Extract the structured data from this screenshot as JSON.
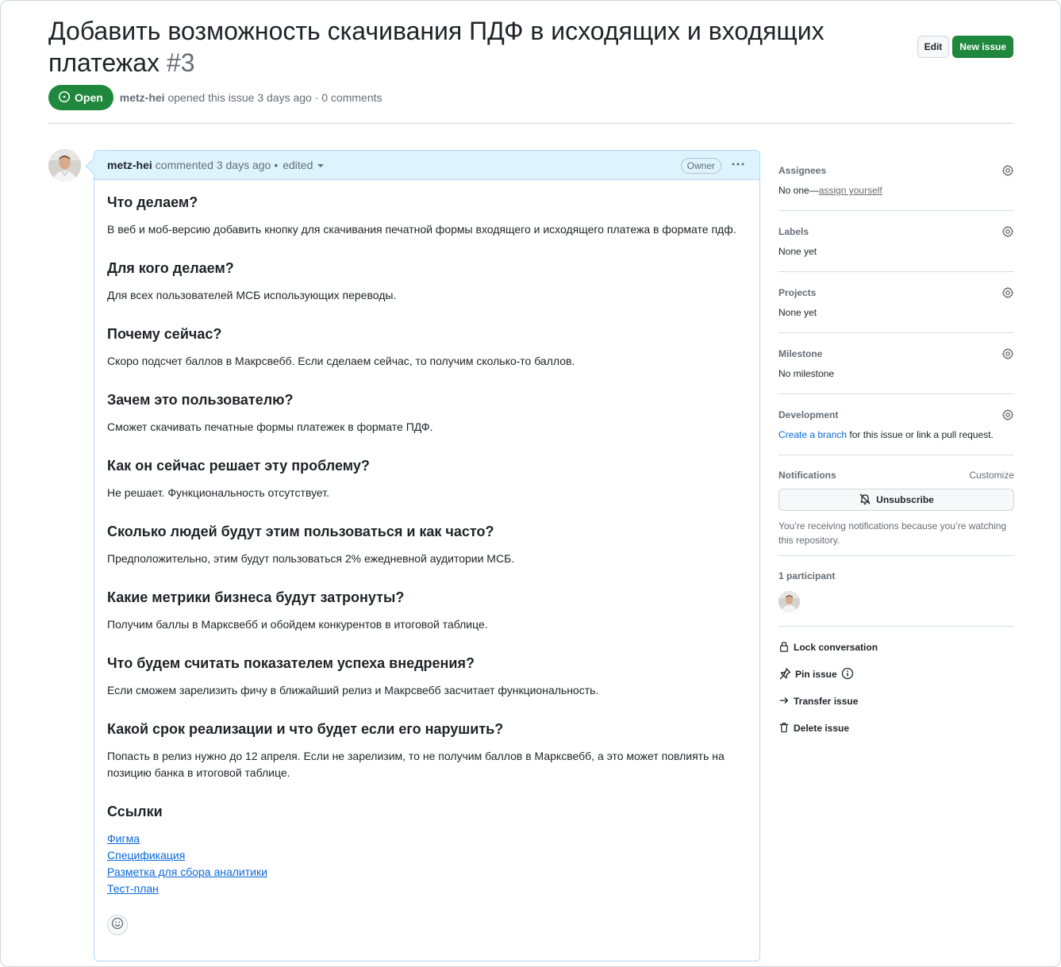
{
  "issue": {
    "title": "Добавить возможность скачивания ПДФ в исходящих и входящих платежах",
    "number": "#3",
    "state": "Open",
    "author": "metz-hei",
    "meta_rest": "opened this issue 3 days ago · 0 comments"
  },
  "actions": {
    "edit": "Edit",
    "new_issue": "New issue"
  },
  "comment": {
    "author": "metz-hei",
    "commented": "commented 3 days ago",
    "separator": "•",
    "edited": "edited",
    "owner_badge": "Owner",
    "sections": [
      {
        "heading": "Что делаем?",
        "text": "В веб и моб-версию добавить кнопку для скачивания печатной формы входящего и исходящего платежа в формате пдф."
      },
      {
        "heading": "Для кого делаем?",
        "text": "Для всех пользователей МСБ использующих переводы."
      },
      {
        "heading": "Почему сейчас?",
        "text": "Скоро подсчет баллов в Макрсвебб. Если сделаем сейчас, то получим сколько-то баллов."
      },
      {
        "heading": "Зачем это пользователю?",
        "text": "Сможет скачивать печатные формы платежек в формате ПДФ."
      },
      {
        "heading": "Как он сейчас решает эту проблему?",
        "text": "Не решает. Функциональность отсутствует."
      },
      {
        "heading": "Сколько людей будут этим пользоваться и как часто?",
        "text": "Предположительно, этим будут пользоваться 2% ежедневной аудитории МСБ."
      },
      {
        "heading": "Какие метрики бизнеса будут затронуты?",
        "text": "Получим баллы в Марксвебб и обойдем конкурентов в итоговой таблице."
      },
      {
        "heading": "Что будем считать показателем успеха внедрения?",
        "text": "Если сможем зарелизить фичу в ближайший релиз и Макрсвебб засчитает функциональность."
      },
      {
        "heading": "Какой срок реализации и что будет если его нарушить?",
        "text": "Попасть в релиз нужно до 12 апреля. Если не зарелизим, то не получим баллов в Марксвебб, а это может повлиять на позицию банка в итоговой таблице."
      }
    ],
    "links_heading": "Ссылки",
    "links": [
      "Фигма",
      "Спецификация",
      "Разметка для сбора аналитики",
      "Тест-план"
    ]
  },
  "sidebar": {
    "assignees": {
      "title": "Assignees",
      "value_prefix": "No one—",
      "value_link": "assign yourself"
    },
    "labels": {
      "title": "Labels",
      "value": "None yet"
    },
    "projects": {
      "title": "Projects",
      "value": "None yet"
    },
    "milestone": {
      "title": "Milestone",
      "value": "No milestone"
    },
    "development": {
      "title": "Development",
      "link": "Create a branch",
      "rest": " for this issue or link a pull request."
    },
    "notifications": {
      "title": "Notifications",
      "customize": "Customize",
      "button": "Unsubscribe",
      "note": "You’re receiving notifications because you’re watching this repository."
    },
    "participants": {
      "title": "1 participant"
    },
    "actions": {
      "lock": "Lock conversation",
      "pin": "Pin issue",
      "transfer": "Transfer issue",
      "delete": "Delete issue"
    }
  },
  "colors": {
    "open_green": "#1f883d",
    "link_blue": "#0969da",
    "comment_header": "#ddf4ff"
  }
}
